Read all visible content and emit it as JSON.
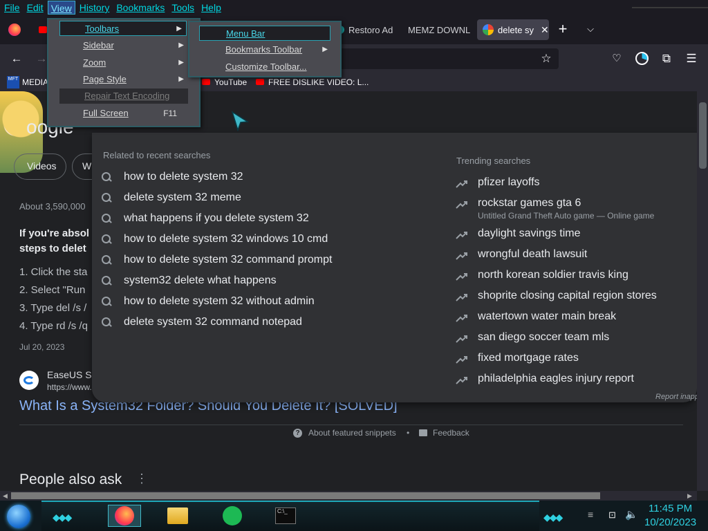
{
  "menubar": {
    "items": [
      "File",
      "Edit",
      "View",
      "History",
      "Bookmarks",
      "Tools",
      "Help"
    ]
  },
  "tabs": [
    {
      "label": "Restoro Ad"
    },
    {
      "label": "MEMZ DOWNL"
    },
    {
      "label": "delete sy"
    }
  ],
  "bookmarks": [
    "MEDIA",
    "YouTube",
    "FREE DISLIKE VIDEO: L..."
  ],
  "view_menu": [
    {
      "label": "Toolbars",
      "submenu": true,
      "selected": true
    },
    {
      "label": "Sidebar",
      "submenu": true
    },
    {
      "label": "Zoom",
      "submenu": true
    },
    {
      "label": "Page Style",
      "submenu": true
    },
    {
      "label": "Repair Text Encoding",
      "disabled": true
    },
    {
      "label": "Full Screen",
      "shortcut": "F11"
    }
  ],
  "toolbars_menu": [
    {
      "label": "Menu Bar",
      "selected": true
    },
    {
      "label": "Bookmarks Toolbar",
      "submenu": true
    },
    {
      "label": "Customize Toolbar..."
    }
  ],
  "page": {
    "logo": "oogle",
    "chips": [
      "Videos",
      "Wi"
    ],
    "about": "About 3,590,000",
    "snippet_bold_1": "If you're absol",
    "snippet_bold_2": "steps to delet",
    "steps": [
      "1. Click the sta",
      "2. Select \"Run",
      "3. Type del /s /",
      "4. Type rd /s /q"
    ],
    "date": "Jul 20, 2023",
    "site_name": "EaseUS So",
    "site_url": "https://www.",
    "result_title": "What Is a System32 Folder? Should You Delete It? [SOLVED]",
    "about_snippets": "About featured snippets",
    "feedback": "Feedback",
    "people_also_ask": "People also ask"
  },
  "suggestions": {
    "related_header": "Related to recent searches",
    "related": [
      "how to delete system 32",
      "delete system 32 meme",
      "what happens if you delete system 32",
      "how to delete system 32 windows 10 cmd",
      "how to delete system 32 command prompt",
      "system32 delete what happens",
      "how to delete system 32 without admin",
      "delete system 32 command notepad"
    ],
    "trending_header": "Trending searches",
    "trending": [
      {
        "label": "pfizer layoffs"
      },
      {
        "label": "rockstar games gta 6",
        "sub": "Untitled Grand Theft Auto game — Online game"
      },
      {
        "label": "daylight savings time"
      },
      {
        "label": "wrongful death lawsuit"
      },
      {
        "label": "north korean soldier travis king"
      },
      {
        "label": "shoprite closing capital region stores"
      },
      {
        "label": "watertown water main break"
      },
      {
        "label": "san diego soccer team mls"
      },
      {
        "label": "fixed mortgage rates"
      },
      {
        "label": "philadelphia eagles injury report"
      }
    ],
    "report": "Report inapp"
  },
  "taskbar": {
    "time": "11:45 PM",
    "date": "10/20/2023"
  },
  "colors": {
    "accent": "#00d6e0",
    "page_bg": "#202124",
    "dropdown_bg": "#303134",
    "link": "#8ab4f8"
  }
}
